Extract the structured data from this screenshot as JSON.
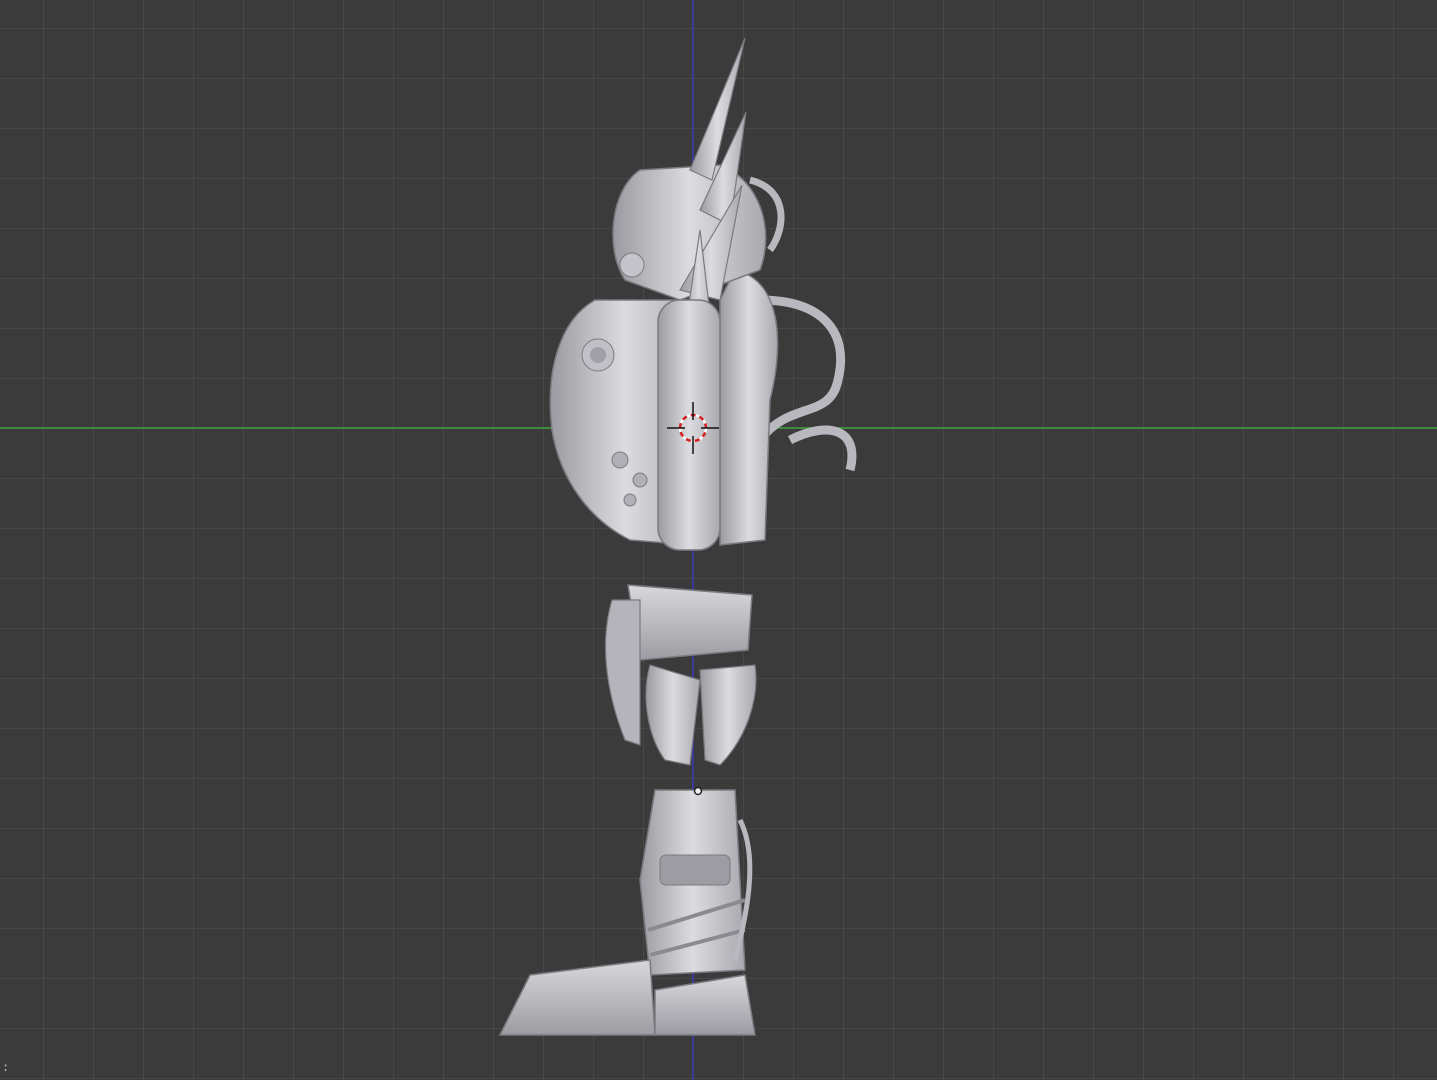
{
  "viewport": {
    "background": "#3b3b3b",
    "grid_color": "#505050",
    "x_axis_color": "#3f8a3f",
    "z_axis_color": "#3a3a9a",
    "model_color": "#c8c8cc",
    "corner_text": ":"
  },
  "icons": {
    "cursor": "3d-cursor-icon",
    "origin": "object-origin-icon"
  }
}
